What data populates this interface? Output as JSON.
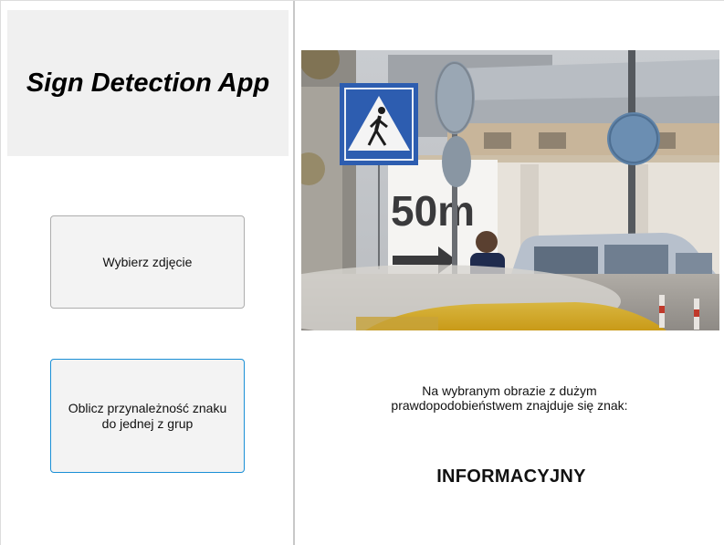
{
  "app": {
    "title": "Sign Detection App"
  },
  "buttons": {
    "choose_image": "Wybierz zdjęcie",
    "compute": "Oblicz przynależność znaku do jednej z grup"
  },
  "image": {
    "sign_text": "50m"
  },
  "result": {
    "description": "Na wybranym obrazie z dużym prawdopodobieństwem znajduje się znak:",
    "class": "INFORMACYJNY"
  },
  "colors": {
    "title_bg": "#f0f0f0",
    "button_bg": "#f3f3f3",
    "button_border": "#adadad",
    "focus_border": "#1a8fd6",
    "sign_blue": "#2d5db0"
  }
}
